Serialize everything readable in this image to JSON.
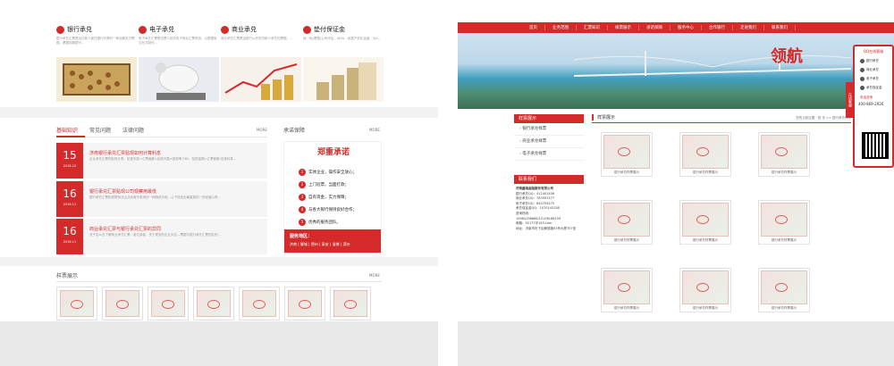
{
  "left": {
    "services": [
      {
        "title": "银行承兑",
        "desc": "银行承兑汇票是由付款人委托银行开具的一种远期支付票据，票据到期银行…"
      },
      {
        "title": "电子承兑",
        "desc": "电子承兑汇票是出票人依托电子商业汇票系统，以数据电文形式制作…"
      },
      {
        "title": "商业承兑",
        "desc": "商业承兑汇票是由银行以外的付款人承兑的票据，…"
      },
      {
        "title": "垫付保证金",
        "desc": "经一轨(票据)公司评估，对A&…依靠产权化运营，为A…"
      }
    ],
    "tabs": [
      "基础知识",
      "常见问题",
      "法律问题"
    ],
    "more": "MORE",
    "news": [
      {
        "day": "15",
        "ym": "2016.12",
        "title": "济南银行承兑汇票贴现如何计算利息",
        "excerpt": "企业承兑汇票的贴现计算，贴现利息=汇票面额×贴现天数×贴现率/360，贴现金额=汇票面额-贴现利息…"
      },
      {
        "day": "16",
        "ym": "2016.11",
        "title": "银行承兑汇票贴现公司观察用最低",
        "excerpt": "银行承兑汇票贴现是商业企业经营中常用的一种融资手段，以下将给出最直接的一些经营心得…"
      },
      {
        "day": "16",
        "ym": "2016.11",
        "title": "商业承兑汇票与银行承兑汇票的异同",
        "excerpt": "关于怎么去了解商业承兑汇票，各位读者，关于更多的企业对应…票据与银行承兑汇票的区别…"
      }
    ],
    "promise": {
      "title": "承诺保障",
      "heading": "郑重承诺",
      "items": [
        "实体企业，操作安全放心；",
        "上门验票，当面打款；",
        "自有资金，实力保障；",
        "与各大银行保持良好合作；",
        "优秀的服务团队。"
      ],
      "area_label": "服务地区：",
      "area": "济南 | 聊城 | 德州 | 泰安 | 淄博 | 滨州"
    },
    "samples_title": "样票展示"
  },
  "right": {
    "nav": [
      "首页",
      "业务范围",
      "汇票知识",
      "样票展示",
      "承诺保障",
      "服务中心",
      "合作银行",
      "走进我们",
      "联系我们"
    ],
    "slogan": "领航",
    "sidebar_title": "样票展示",
    "sidebar_items": [
      "银行承兑样票",
      "商业承兑样票",
      "电子承兑样票"
    ],
    "contact_title": "联系我们",
    "contact_lines": [
      "济南鑫瑞金融服务有限公司",
      "银行承兑QQ：412401406",
      "商业承兑QQ：783597477",
      "电子承兑QQ：840755475",
      "承兑保证金QQ：1070145158",
      "咨询热线：",
      "15964198666/15156166159",
      "邮箱：92177@163.com",
      "地址：济南市历下区解放路93号大厦707室"
    ],
    "content_title": "样票展示",
    "breadcrumb": "您的当前位置：首 页 >> 银行承兑样票",
    "gallery_caption": "银行承兑样票展示",
    "qq_panel": {
      "header": "QQ在线客服",
      "items": [
        "银行承兑",
        "商业承兑",
        "电子承兑",
        "承兑保证金"
      ],
      "tel_label": "电话咨询",
      "tel": "400-869-2926"
    },
    "float_tab": "在线客服"
  }
}
